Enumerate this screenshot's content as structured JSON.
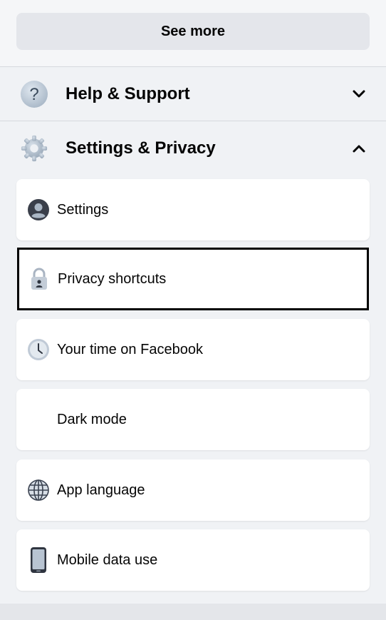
{
  "see_more": {
    "label": "See more"
  },
  "sections": {
    "help": {
      "label": "Help & Support",
      "icon": "question-icon",
      "expanded": false
    },
    "settings_privacy": {
      "label": "Settings & Privacy",
      "icon": "gear-icon",
      "expanded": true
    }
  },
  "settings_menu": {
    "items": [
      {
        "label": "Settings",
        "icon": "user-circle-icon",
        "selected": false
      },
      {
        "label": "Privacy shortcuts",
        "icon": "lock-icon",
        "selected": true
      },
      {
        "label": "Your time on Facebook",
        "icon": "clock-icon",
        "selected": false
      },
      {
        "label": "Dark mode",
        "icon": "moon-icon",
        "selected": false
      },
      {
        "label": "App language",
        "icon": "globe-icon",
        "selected": false
      },
      {
        "label": "Mobile data use",
        "icon": "phone-icon",
        "selected": false
      }
    ]
  },
  "colors": {
    "background": "#f0f2f5",
    "card": "#ffffff",
    "button": "#e4e6eb",
    "icon_fill": "#a9b4c2",
    "selected_border": "#000000"
  }
}
